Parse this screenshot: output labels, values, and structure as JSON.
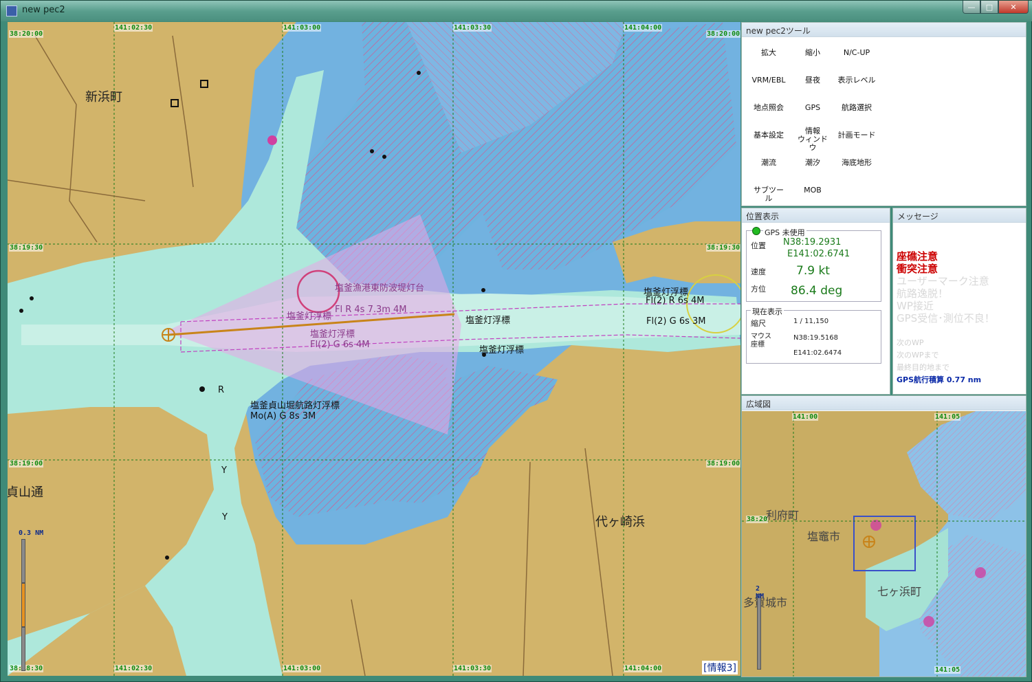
{
  "window": {
    "title": "new pec2"
  },
  "chart": {
    "coords_top": [
      "38:20:00",
      "141:02:30",
      "141:03:00",
      "141:03:30",
      "141:04:00",
      "38:20:00"
    ],
    "coords_mid_lat": "38:19:30",
    "coords_low_lat": "38:19:00",
    "coords_bottom": [
      "38:18:30",
      "141:02:30",
      "141:03:00",
      "141:03:30",
      "141:04:00"
    ],
    "places": {
      "shinhama": "新浜町",
      "sadayama": "貞山通",
      "yogasaki": "代ヶ崎浜"
    },
    "labels": {
      "breakwater": "塩釜漁港東防波堤灯台",
      "breakwater_light": "Fl R 4s 7.3m 4M",
      "buoy1": "塩釜灯浮標",
      "buoy1_char": "Fl(2) G 6s 4M",
      "buoy_left_top": "塩釜灯浮標",
      "buoy_mid": "塩釜灯浮標",
      "buoy_low": "塩釜灯浮標",
      "buoy_right": "塩釜灯浮標",
      "buoy_right_char": "Fl(2) R 6s 4M",
      "buoy_right2_char": "Fl(2) G 6s 3M",
      "sadayama_buoy": "塩釜貞山堀航路灯浮標",
      "sadayama_char": "Mo(A) G 8s 3M",
      "r_mark": "R",
      "y_mark": "Y"
    },
    "scale_label": "0.3 NM",
    "info_tag": "[情報3]"
  },
  "tools_panel": {
    "title": "new pec2ツール",
    "buttons": [
      "拡大",
      "縮小",
      "N/C-UP",
      "VRM/EBL",
      "昼夜",
      "表示レベル",
      "地点照会",
      "GPS",
      "航路選択",
      "基本設定",
      "情報\nウィンドウ",
      "計画モード",
      "潮流",
      "潮汐",
      "海底地形",
      "サブツール",
      "MOB"
    ]
  },
  "position_panel": {
    "title": "位置表示",
    "gps_status": "GPS 未使用",
    "position_label": "位置",
    "lat": "N38:19.2931",
    "lon": "E141:02.6741",
    "speed_label": "速度",
    "speed": "7.9 kt",
    "heading_label": "方位",
    "heading": "86.4 deg",
    "current_title": "現在表示",
    "scale_label": "縮尺",
    "scale": "1 / 11,150",
    "mouse_label": "マウス\n座標",
    "mouse_lat": "N38:19.5168",
    "mouse_lon": "E141:02.6474",
    "status_color": "#22bb22"
  },
  "message_panel": {
    "title": "メッセージ",
    "alerts": [
      "座礁注意",
      "衝突注意"
    ],
    "inactive": [
      "ユーザーマーク注意",
      "航路逸脱！",
      "WP接近",
      "GPS受信･測位不良！"
    ],
    "wp": [
      "次のWP",
      "次のWPまで",
      "最終目的地まで"
    ],
    "gps_total": "GPS航行積算  0.77 nm",
    "alert_color": "#cc0000"
  },
  "overview_panel": {
    "title": "広域図",
    "coord_top1": "141:00",
    "coord_top2": "141:05",
    "coord_left": "38:20",
    "coord_bottom": "141:05",
    "places": [
      "利府町",
      "塩竈市",
      "七ヶ浜町",
      "多賀城市"
    ],
    "scale_label": "2 NM"
  }
}
